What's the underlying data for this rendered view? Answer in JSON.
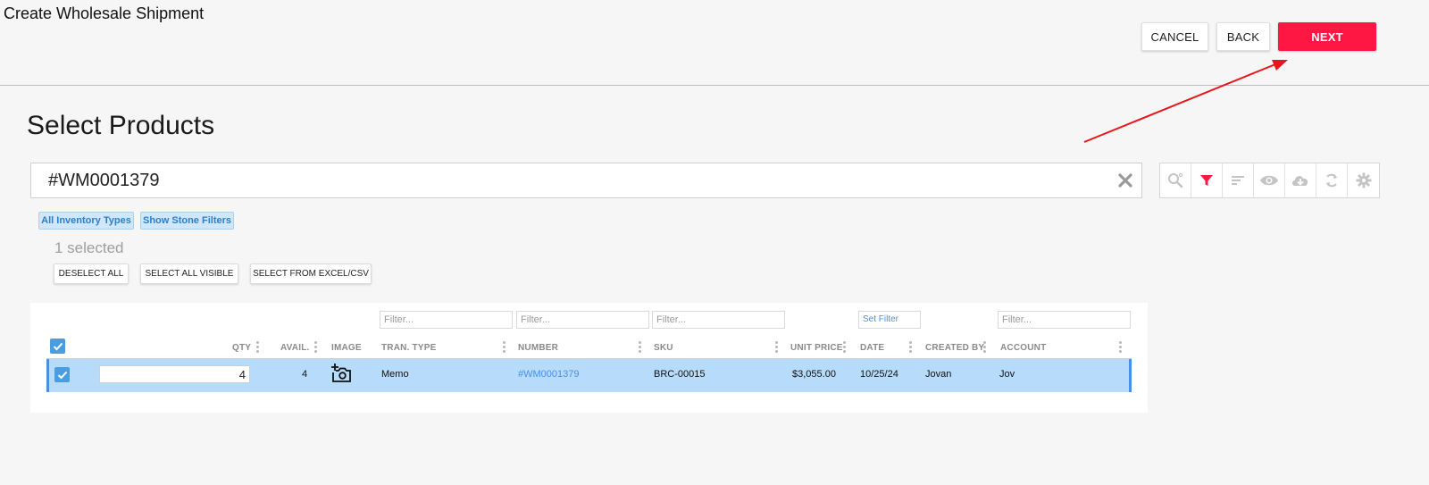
{
  "header": {
    "title": "Create Wholesale Shipment",
    "cancel_label": "CANCEL",
    "back_label": "BACK",
    "next_label": "NEXT"
  },
  "section_title": "Select Products",
  "search": {
    "value": "#WM0001379"
  },
  "toolbar": {
    "icons": [
      "search-options-icon",
      "filter-icon",
      "sort-icon",
      "eye-icon",
      "cloud-download-icon",
      "refresh-icon",
      "gear-icon"
    ],
    "active_color": "#ff1744",
    "icon_color": "#c4c4c4"
  },
  "chips": {
    "inventory_types": "All Inventory Types",
    "stone_filters": "Show Stone Filters"
  },
  "selection": {
    "count_text": "1 selected",
    "deselect_all": "DESELECT ALL",
    "select_all_visible": "SELECT ALL VISIBLE",
    "select_from_excel": "SELECT FROM EXCEL/CSV"
  },
  "grid": {
    "filters": {
      "tran_type_placeholder": "Filter...",
      "number_placeholder": "Filter...",
      "sku_placeholder": "Filter...",
      "date_label": "Set Filter",
      "account_placeholder": "Filter..."
    },
    "columns": {
      "qty": "QTY",
      "avail": "AVAIL.",
      "image": "IMAGE",
      "tran_type": "TRAN. TYPE",
      "number": "NUMBER",
      "sku": "SKU",
      "unit_price": "UNIT PRICE",
      "date": "DATE",
      "created_by": "CREATED BY",
      "account": "ACCOUNT"
    },
    "rows": [
      {
        "selected": true,
        "qty": "4",
        "avail": "4",
        "image_icon": "add-photo-icon",
        "tran_type": "Memo",
        "number": "#WM0001379",
        "sku": "BRC-00015",
        "unit_price": "$3,055.00",
        "date": "10/25/24",
        "created_by": "Jovan",
        "account": "Jov"
      }
    ]
  },
  "colors": {
    "primary": "#ff1744",
    "row_selected": "#b6dbfb",
    "accent_blue": "#4a90e2",
    "annotation_arrow": "#e8151b"
  }
}
